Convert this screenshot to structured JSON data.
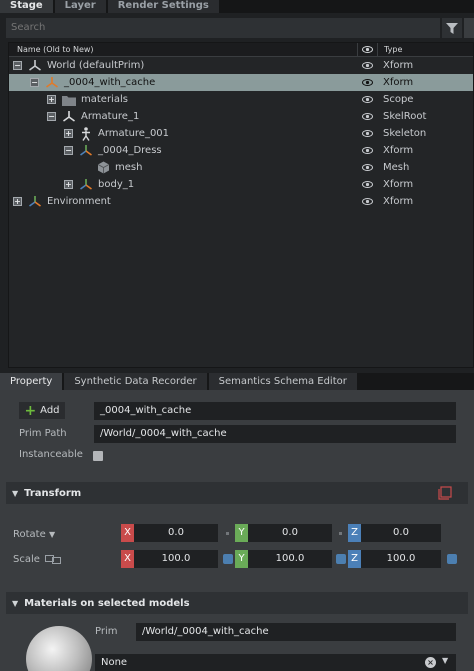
{
  "top_tabs": [
    "Stage",
    "Layer",
    "Render Settings"
  ],
  "search": {
    "placeholder": "Search"
  },
  "tree": {
    "columns": {
      "name": "Name (Old to New)",
      "type": "Type"
    },
    "rows": [
      {
        "label": "World (defaultPrim)",
        "type": "Xform"
      },
      {
        "label": "_0004_with_cache",
        "type": "Xform"
      },
      {
        "label": "materials",
        "type": "Scope"
      },
      {
        "label": "Armature_1",
        "type": "SkelRoot"
      },
      {
        "label": "Armature_001",
        "type": "Skeleton"
      },
      {
        "label": "_0004_Dress",
        "type": "Xform"
      },
      {
        "label": "mesh",
        "type": "Mesh"
      },
      {
        "label": "body_1",
        "type": "Xform"
      },
      {
        "label": "Environment",
        "type": "Xform"
      }
    ]
  },
  "property_tabs": [
    "Property",
    "Synthetic Data Recorder",
    "Semantics Schema Editor"
  ],
  "property": {
    "add_label": "Add",
    "prim_name": "_0004_with_cache",
    "prim_path_label": "Prim Path",
    "prim_path": "/World/_0004_with_cache",
    "instanceable_label": "Instanceable",
    "instanceable": false
  },
  "transform": {
    "title": "Transform",
    "rotate_label": "Rotate",
    "scale_label": "Scale",
    "rotate": {
      "x": "0.0",
      "y": "0.0",
      "z": "0.0"
    },
    "scale": {
      "x": "100.0",
      "y": "100.0",
      "z": "100.0"
    }
  },
  "axis_labels": {
    "x": "X",
    "y": "Y",
    "z": "Z"
  },
  "materials": {
    "title": "Materials on selected models",
    "prim_label": "Prim",
    "prim_path": "/World/_0004_with_cache",
    "material": "None"
  },
  "colors": {
    "selection": "#8a9b9b",
    "x_axis": "#c94b4b",
    "y_axis": "#6aab58",
    "z_axis": "#4b80b8",
    "add_icon": "#6dbb3c"
  }
}
